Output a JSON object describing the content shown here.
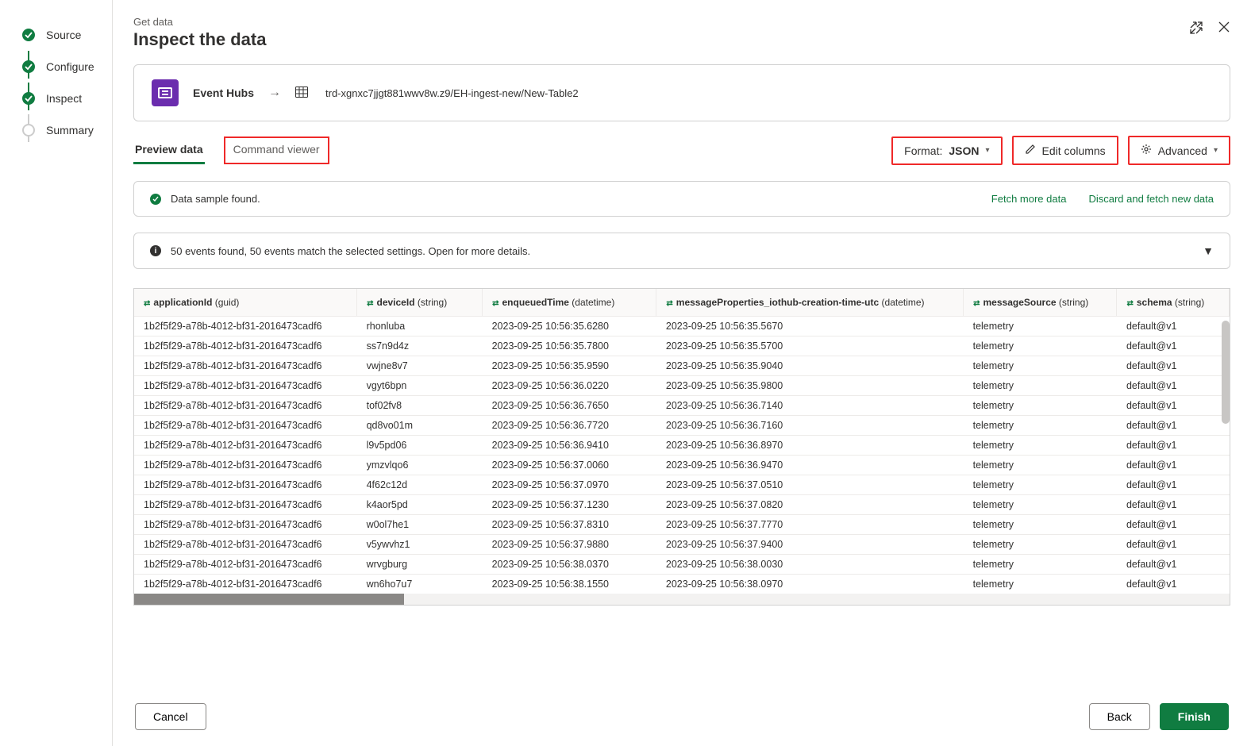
{
  "header": {
    "subtitle": "Get data",
    "title": "Inspect the data"
  },
  "steps": [
    {
      "label": "Source",
      "done": true
    },
    {
      "label": "Configure",
      "done": true
    },
    {
      "label": "Inspect",
      "done": true
    },
    {
      "label": "Summary",
      "done": false
    }
  ],
  "source": {
    "connector_label": "Event Hubs",
    "path": "trd-xgnxc7jjgt881wwv8w.z9/EH-ingest-new/New-Table2"
  },
  "tabs": {
    "preview": "Preview data",
    "command": "Command viewer"
  },
  "toolbar": {
    "format_label": "Format:",
    "format_value": "JSON",
    "edit_columns": "Edit columns",
    "advanced": "Advanced"
  },
  "banners": {
    "sample_found": "Data sample found.",
    "fetch_more": "Fetch more data",
    "discard_fetch": "Discard and fetch new data",
    "events_info": "50 events found, 50 events match the selected settings. Open for more details."
  },
  "table": {
    "columns": [
      {
        "name": "applicationId",
        "type": "guid"
      },
      {
        "name": "deviceId",
        "type": "string"
      },
      {
        "name": "enqueuedTime",
        "type": "datetime"
      },
      {
        "name": "messageProperties_iothub-creation-time-utc",
        "type": "datetime"
      },
      {
        "name": "messageSource",
        "type": "string"
      },
      {
        "name": "schema",
        "type": "string"
      }
    ],
    "rows": [
      [
        "1b2f5f29-a78b-4012-bf31-2016473cadf6",
        "rhonluba",
        "2023-09-25 10:56:35.6280",
        "2023-09-25 10:56:35.5670",
        "telemetry",
        "default@v1"
      ],
      [
        "1b2f5f29-a78b-4012-bf31-2016473cadf6",
        "ss7n9d4z",
        "2023-09-25 10:56:35.7800",
        "2023-09-25 10:56:35.5700",
        "telemetry",
        "default@v1"
      ],
      [
        "1b2f5f29-a78b-4012-bf31-2016473cadf6",
        "vwjne8v7",
        "2023-09-25 10:56:35.9590",
        "2023-09-25 10:56:35.9040",
        "telemetry",
        "default@v1"
      ],
      [
        "1b2f5f29-a78b-4012-bf31-2016473cadf6",
        "vgyt6bpn",
        "2023-09-25 10:56:36.0220",
        "2023-09-25 10:56:35.9800",
        "telemetry",
        "default@v1"
      ],
      [
        "1b2f5f29-a78b-4012-bf31-2016473cadf6",
        "tof02fv8",
        "2023-09-25 10:56:36.7650",
        "2023-09-25 10:56:36.7140",
        "telemetry",
        "default@v1"
      ],
      [
        "1b2f5f29-a78b-4012-bf31-2016473cadf6",
        "qd8vo01m",
        "2023-09-25 10:56:36.7720",
        "2023-09-25 10:56:36.7160",
        "telemetry",
        "default@v1"
      ],
      [
        "1b2f5f29-a78b-4012-bf31-2016473cadf6",
        "l9v5pd06",
        "2023-09-25 10:56:36.9410",
        "2023-09-25 10:56:36.8970",
        "telemetry",
        "default@v1"
      ],
      [
        "1b2f5f29-a78b-4012-bf31-2016473cadf6",
        "ymzvlqo6",
        "2023-09-25 10:56:37.0060",
        "2023-09-25 10:56:36.9470",
        "telemetry",
        "default@v1"
      ],
      [
        "1b2f5f29-a78b-4012-bf31-2016473cadf6",
        "4f62c12d",
        "2023-09-25 10:56:37.0970",
        "2023-09-25 10:56:37.0510",
        "telemetry",
        "default@v1"
      ],
      [
        "1b2f5f29-a78b-4012-bf31-2016473cadf6",
        "k4aor5pd",
        "2023-09-25 10:56:37.1230",
        "2023-09-25 10:56:37.0820",
        "telemetry",
        "default@v1"
      ],
      [
        "1b2f5f29-a78b-4012-bf31-2016473cadf6",
        "w0ol7he1",
        "2023-09-25 10:56:37.8310",
        "2023-09-25 10:56:37.7770",
        "telemetry",
        "default@v1"
      ],
      [
        "1b2f5f29-a78b-4012-bf31-2016473cadf6",
        "v5ywvhz1",
        "2023-09-25 10:56:37.9880",
        "2023-09-25 10:56:37.9400",
        "telemetry",
        "default@v1"
      ],
      [
        "1b2f5f29-a78b-4012-bf31-2016473cadf6",
        "wrvgburg",
        "2023-09-25 10:56:38.0370",
        "2023-09-25 10:56:38.0030",
        "telemetry",
        "default@v1"
      ],
      [
        "1b2f5f29-a78b-4012-bf31-2016473cadf6",
        "wn6ho7u7",
        "2023-09-25 10:56:38.1550",
        "2023-09-25 10:56:38.0970",
        "telemetry",
        "default@v1"
      ]
    ]
  },
  "footer": {
    "cancel": "Cancel",
    "back": "Back",
    "finish": "Finish"
  }
}
